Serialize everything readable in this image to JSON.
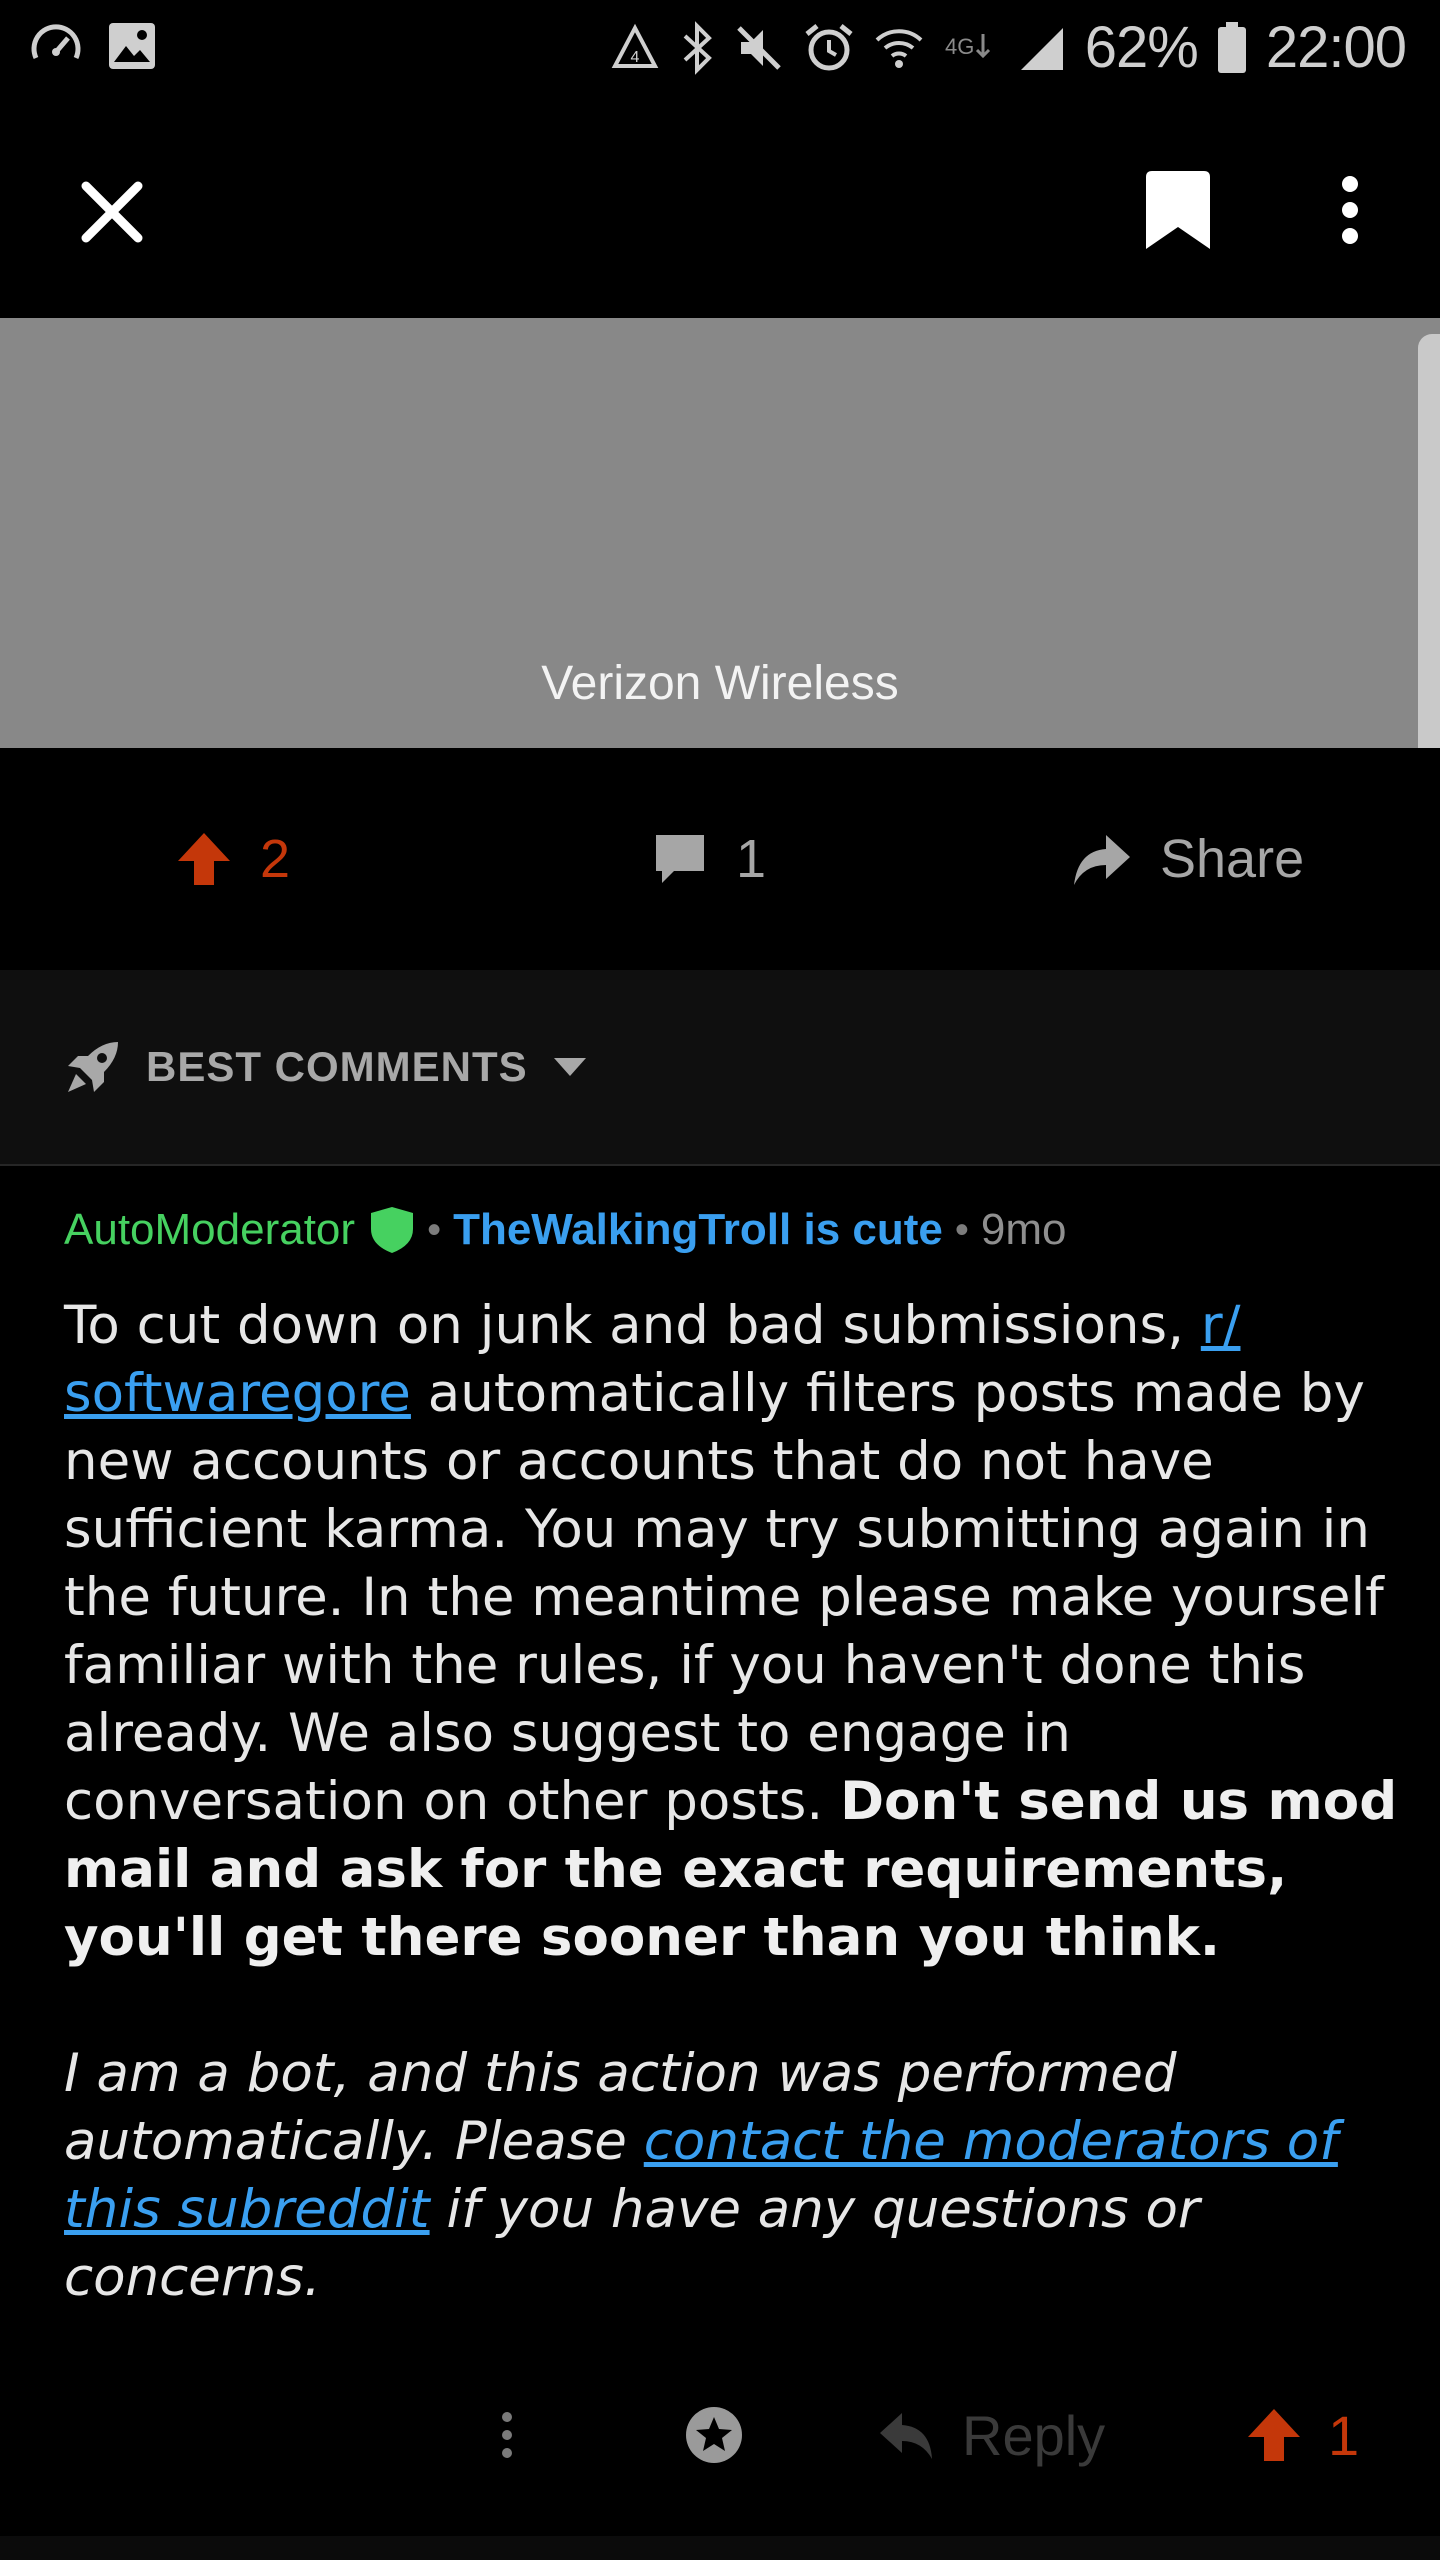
{
  "status_bar": {
    "battery": "62%",
    "time": "22:00"
  },
  "app_bar": {
    "close_icon": "close-icon",
    "bookmark_icon": "bookmark-icon",
    "more_icon": "more-vertical-icon"
  },
  "media": {
    "caption": "Verizon Wireless"
  },
  "actions": {
    "upvotes": "2",
    "comments": "1",
    "share_label": "Share"
  },
  "sort": {
    "label": "BEST COMMENTS"
  },
  "comment": {
    "author": "AutoModerator",
    "flair": "TheWalkingTroll is cute",
    "age": "9mo",
    "p1_pre": "To cut down on junk and bad submissions, ",
    "subreddit_link": "r/ softwaregore",
    "p1_mid": " automatically filters posts made by new accounts or accounts that do not have sufficient karma. You may try submitting again in the future. In the meantime please make yourself familiar with the rules, if you haven't done this already. We also suggest to engage in conversation on other posts. ",
    "p1_bold": "Don't send us mod mail and ask for the exact requirements, you'll get there sooner than you think.",
    "p2_pre": "I am a bot, and this action was performed automatically. Please ",
    "p2_link": "contact the moderators of this subreddit",
    "p2_post": " if you have any questions or concerns.",
    "reply_label": "Reply",
    "score": "1"
  },
  "colors": {
    "upvote": "#c4370a",
    "link": "#3a9ff0",
    "mod_green": "#46d160"
  }
}
